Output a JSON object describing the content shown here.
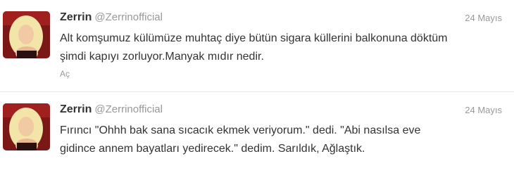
{
  "tweets": [
    {
      "fullname": "Zerrin",
      "username": "@Zerrinofficial",
      "time": "24 Mayıs",
      "text": "Alt komşumuz külümüze muhtaç diye bütün sigara küllerini balkonuna döktüm şimdi kapıyı zorluyor.Manyak mıdır nedir.",
      "action": "Aç"
    },
    {
      "fullname": "Zerrin",
      "username": "@Zerrinofficial",
      "time": "24 Mayıs",
      "text": "Fırıncı \"Ohhh bak sana sıcacık ekmek veriyorum.\" dedi. \"Abi nasılsa eve gidince annem bayatları yedirecek.\" dedim. Sarıldık, Ağlaştık."
    }
  ]
}
